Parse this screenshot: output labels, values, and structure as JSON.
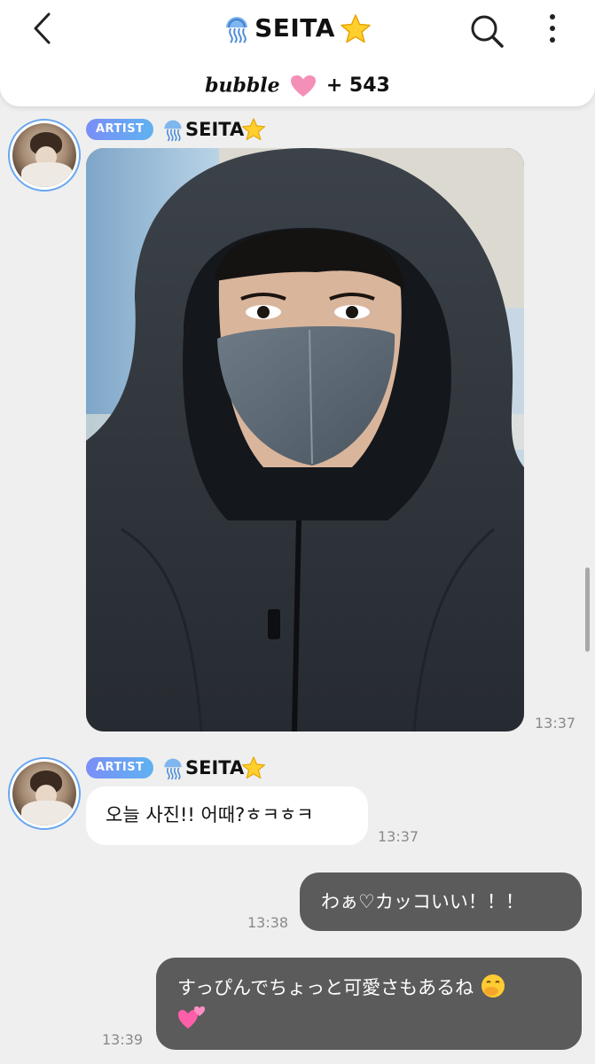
{
  "header": {
    "title": "SEITA",
    "title_emoji_left": "jellyfish-icon",
    "title_emoji_right": "star-icon",
    "bubble_brand": "bubble",
    "bubble_heart": "pink-heart-icon",
    "bubble_count": "+ 543"
  },
  "messages": [
    {
      "type": "photo",
      "badge": "ARTIST",
      "sender": "SEITA",
      "time": "13:37"
    },
    {
      "type": "text",
      "badge": "ARTIST",
      "sender": "SEITA",
      "text": "오늘 사진!! 어때?ㅎㅋㅎㅋ",
      "time": "13:37"
    },
    {
      "type": "own",
      "text": "わぁ♡カッコいい！！！",
      "time": "13:38"
    },
    {
      "type": "own",
      "line1": "すっぴんでちょっと可愛さもあるね",
      "time": "13:39"
    }
  ],
  "colors": {
    "badge_gradient_start": "#7a8ef7",
    "badge_gradient_end": "#5fb2f0",
    "own_bubble": "#5b5b5b",
    "background": "#efefef",
    "avatar_ring": "#6aa7f0"
  }
}
